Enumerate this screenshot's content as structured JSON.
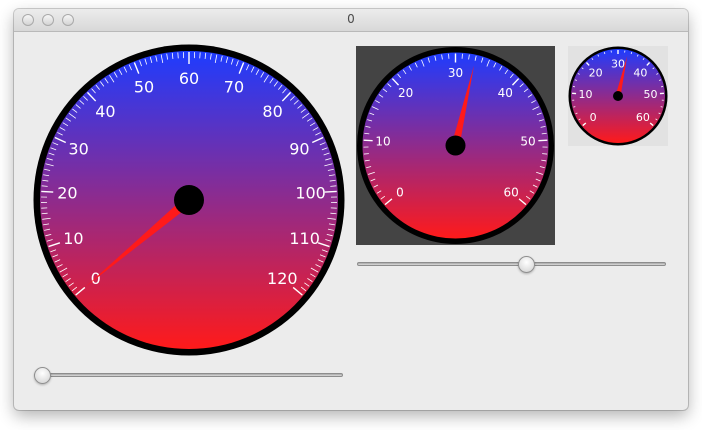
{
  "window": {
    "title": "0"
  },
  "gauges": [
    {
      "id": "large",
      "min": 0,
      "max": 120,
      "value": 0,
      "labels": [
        "0",
        "10",
        "20",
        "30",
        "40",
        "50",
        "60",
        "70",
        "80",
        "90",
        "100",
        "110",
        "120"
      ],
      "background": "none",
      "bezel_color": "#000000"
    },
    {
      "id": "medium",
      "min": 0,
      "max": 60,
      "value": 33,
      "labels": [
        "0",
        "10",
        "20",
        "30",
        "40",
        "50",
        "60"
      ],
      "background": "#444444",
      "bezel_color": "#000000"
    },
    {
      "id": "small",
      "min": 0,
      "max": 60,
      "value": 33,
      "labels": [
        "0",
        "10",
        "20",
        "30",
        "40",
        "50",
        "60"
      ],
      "background": "#e2e2e2",
      "bezel_color": "#000000"
    }
  ],
  "sliders": [
    {
      "id": "large-slider",
      "value": 0,
      "min": 0,
      "max": 120
    },
    {
      "id": "medium-slider",
      "value": 33,
      "min": 0,
      "max": 60
    }
  ],
  "colors": {
    "dial_top": "#1e3cff",
    "dial_bottom": "#ff1a1a",
    "needle": "#ff1a1a",
    "hub": "#000000",
    "tick": "#ffffff",
    "label": "#ffffff"
  }
}
